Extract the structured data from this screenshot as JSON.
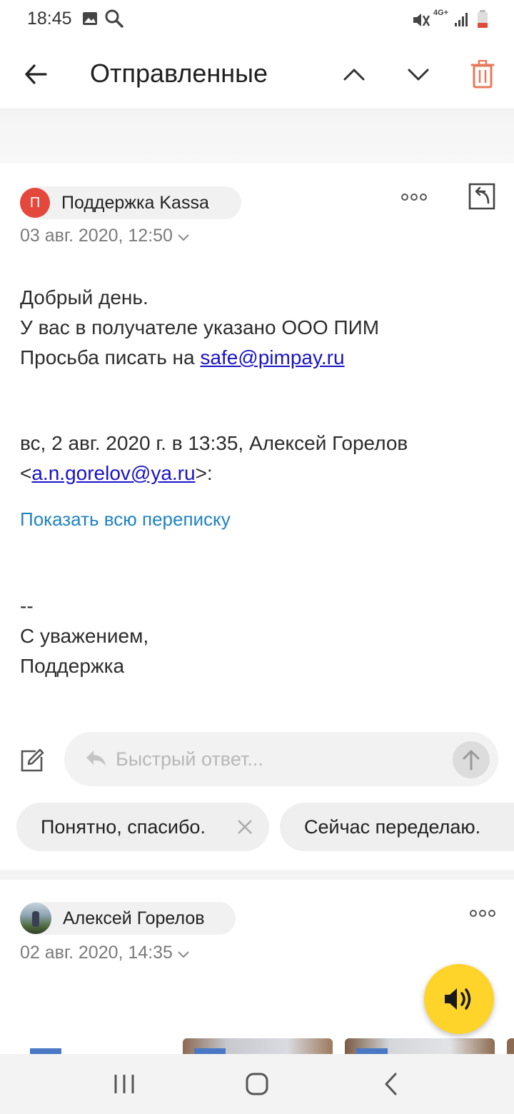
{
  "status_bar": {
    "time": "18:45",
    "network": "4G+"
  },
  "header": {
    "title": "Отправленные"
  },
  "message1": {
    "avatar_letter": "П",
    "sender": "Поддержка Kassa",
    "date": "03 авг. 2020, 12:50",
    "body_line1": "Добрый день.",
    "body_line2": "У вас в получателе указано ООО ПИМ",
    "body_line3_prefix": "Просьба писать на ",
    "body_line3_link": "safe@pimpay.ru",
    "quote_line1": "вс, 2 авг. 2020 г. в 13:35, Алексей Горелов",
    "quote_lt": "<",
    "quote_link": "a.n.gorelov@ya.ru",
    "quote_gt": ">:",
    "show_all": "Показать всю переписку",
    "sig_dash": "--",
    "sig_line1": "С уважением,",
    "sig_line2": "Поддержка"
  },
  "quick_reply": {
    "placeholder": "Быстрый ответ...",
    "suggestions": [
      "Понятно, спасибо.",
      "Сейчас переделаю."
    ]
  },
  "message2": {
    "sender": "Алексей Горелов",
    "date": "02 авг. 2020, 14:35"
  },
  "colors": {
    "accent_delete": "#e8785a",
    "link": "#1a14c4",
    "show_all": "#1f82c2",
    "fab": "#fed42b",
    "avatar": "#e4483d"
  }
}
